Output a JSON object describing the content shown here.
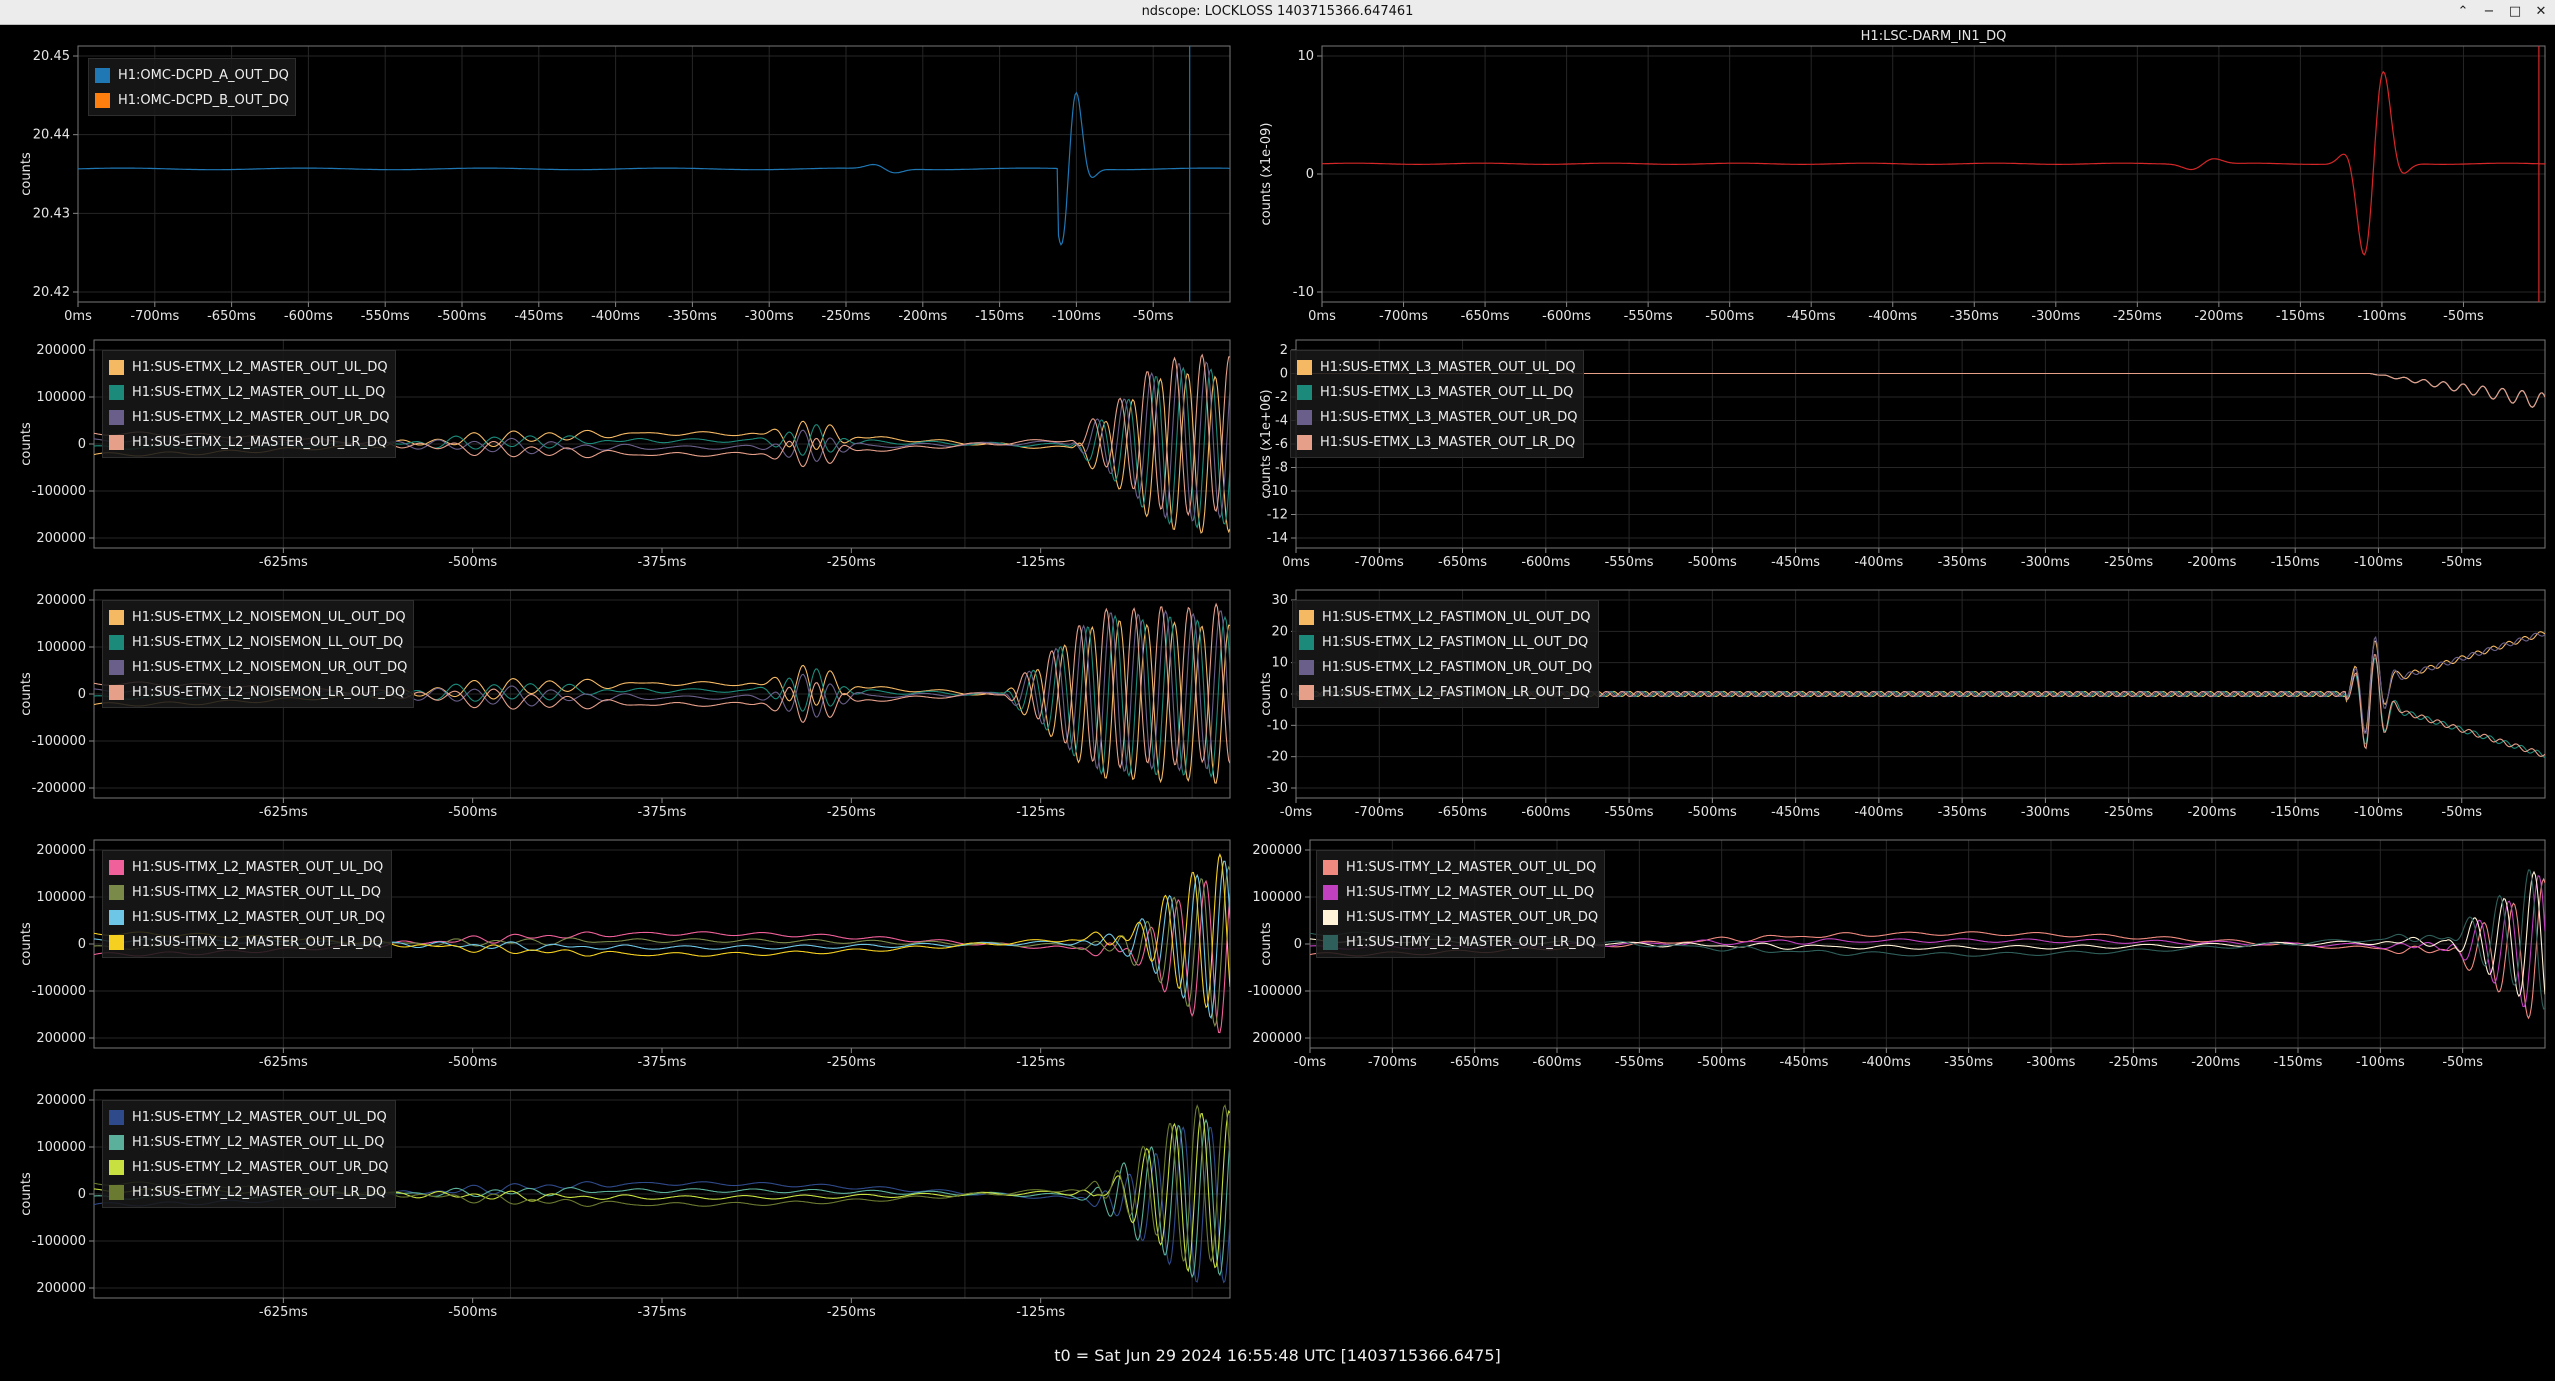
{
  "window": {
    "title": "ndscope: LOCKLOSS 1403715366.647461",
    "controls": [
      "⌃",
      "−",
      "□",
      "✕"
    ]
  },
  "footer": {
    "t0": "t0 = Sat Jun 29 2024 16:55:48 UTC [1403715366.6475]"
  },
  "plots": [
    {
      "id": "p1",
      "title": "",
      "ylabel": "counts",
      "yticks": [
        "20.45",
        "20.44",
        "20.43",
        "20.42"
      ],
      "xticks": [
        "0ms",
        "-700ms",
        "-650ms",
        "-600ms",
        "-550ms",
        "-500ms",
        "-450ms",
        "-400ms",
        "-350ms",
        "-300ms",
        "-250ms",
        "-200ms",
        "-150ms",
        "-100ms",
        "-50ms"
      ],
      "legend": [
        {
          "label": "H1:OMC-DCPD_A_OUT_DQ",
          "color": "#1f77b4"
        },
        {
          "label": "H1:OMC-DCPD_B_OUT_DQ",
          "color": "#ff7f0e"
        }
      ]
    },
    {
      "id": "p2",
      "title": "H1:LSC-DARM_IN1_DQ",
      "ylabel": "counts (x1e-09)",
      "yticks": [
        "10",
        "0",
        "-10"
      ],
      "xticks": [
        "0ms",
        "-700ms",
        "-650ms",
        "-600ms",
        "-550ms",
        "-500ms",
        "-450ms",
        "-400ms",
        "-350ms",
        "-300ms",
        "-250ms",
        "-200ms",
        "-150ms",
        "-100ms",
        "-50ms"
      ],
      "legend": []
    },
    {
      "id": "p3",
      "title": "",
      "ylabel": "counts",
      "yticks": [
        "200000",
        "100000",
        "0",
        "-100000",
        "200000"
      ],
      "xticks": [
        "-625ms",
        "-500ms",
        "-375ms",
        "-250ms",
        "-125ms"
      ],
      "legend": [
        {
          "label": "H1:SUS-ETMX_L2_MASTER_OUT_UL_DQ",
          "color": "#f5b964"
        },
        {
          "label": "H1:SUS-ETMX_L2_MASTER_OUT_LL_DQ",
          "color": "#1b8a7a"
        },
        {
          "label": "H1:SUS-ETMX_L2_MASTER_OUT_UR_DQ",
          "color": "#6a5f8a"
        },
        {
          "label": "H1:SUS-ETMX_L2_MASTER_OUT_LR_DQ",
          "color": "#e6a08a"
        }
      ]
    },
    {
      "id": "p4",
      "title": "",
      "ylabel": "counts (x1e+06)",
      "yticks": [
        "2",
        "0",
        "-2",
        "-4",
        "-6",
        "-8",
        "-10",
        "-12",
        "-14"
      ],
      "xticks": [
        "0ms",
        "-700ms",
        "-650ms",
        "-600ms",
        "-550ms",
        "-500ms",
        "-450ms",
        "-400ms",
        "-350ms",
        "-300ms",
        "-250ms",
        "-200ms",
        "-150ms",
        "-100ms",
        "-50ms"
      ],
      "legend": [
        {
          "label": "H1:SUS-ETMX_L3_MASTER_OUT_UL_DQ",
          "color": "#f5b964"
        },
        {
          "label": "H1:SUS-ETMX_L3_MASTER_OUT_LL_DQ",
          "color": "#1b8a7a"
        },
        {
          "label": "H1:SUS-ETMX_L3_MASTER_OUT_UR_DQ",
          "color": "#6a5f8a"
        },
        {
          "label": "H1:SUS-ETMX_L3_MASTER_OUT_LR_DQ",
          "color": "#e6a08a"
        }
      ]
    },
    {
      "id": "p5",
      "title": "",
      "ylabel": "counts",
      "yticks": [
        "200000",
        "100000",
        "0",
        "-100000",
        "-200000"
      ],
      "xticks": [
        "-625ms",
        "-500ms",
        "-375ms",
        "-250ms",
        "-125ms"
      ],
      "legend": [
        {
          "label": "H1:SUS-ETMX_L2_NOISEMON_UL_OUT_DQ",
          "color": "#f5b964"
        },
        {
          "label": "H1:SUS-ETMX_L2_NOISEMON_LL_OUT_DQ",
          "color": "#1b8a7a"
        },
        {
          "label": "H1:SUS-ETMX_L2_NOISEMON_UR_OUT_DQ",
          "color": "#6a5f8a"
        },
        {
          "label": "H1:SUS-ETMX_L2_NOISEMON_LR_OUT_DQ",
          "color": "#e6a08a"
        }
      ]
    },
    {
      "id": "p6",
      "title": "",
      "ylabel": "counts",
      "yticks": [
        "30",
        "20",
        "10",
        "0",
        "-10",
        "-20",
        "-30"
      ],
      "xticks": [
        "-0ms",
        "-700ms",
        "-650ms",
        "-600ms",
        "-550ms",
        "-500ms",
        "-450ms",
        "-400ms",
        "-350ms",
        "-300ms",
        "-250ms",
        "-200ms",
        "-150ms",
        "-100ms",
        "-50ms"
      ],
      "legend": [
        {
          "label": "H1:SUS-ETMX_L2_FASTIMON_UL_OUT_DQ",
          "color": "#f5b964"
        },
        {
          "label": "H1:SUS-ETMX_L2_FASTIMON_LL_OUT_DQ",
          "color": "#1b8a7a"
        },
        {
          "label": "H1:SUS-ETMX_L2_FASTIMON_UR_OUT_DQ",
          "color": "#6a5f8a"
        },
        {
          "label": "H1:SUS-ETMX_L2_FASTIMON_LR_OUT_DQ",
          "color": "#e6a08a"
        }
      ]
    },
    {
      "id": "p7",
      "title": "",
      "ylabel": "counts",
      "yticks": [
        "200000",
        "100000",
        "0",
        "-100000",
        "200000"
      ],
      "xticks": [
        "-625ms",
        "-500ms",
        "-375ms",
        "-250ms",
        "-125ms"
      ],
      "legend": [
        {
          "label": "H1:SUS-ITMX_L2_MASTER_OUT_UL_DQ",
          "color": "#f0609a"
        },
        {
          "label": "H1:SUS-ITMX_L2_MASTER_OUT_LL_DQ",
          "color": "#7a8a48"
        },
        {
          "label": "H1:SUS-ITMX_L2_MASTER_OUT_UR_DQ",
          "color": "#6ec6e6"
        },
        {
          "label": "H1:SUS-ITMX_L2_MASTER_OUT_LR_DQ",
          "color": "#f5d020"
        }
      ]
    },
    {
      "id": "p8",
      "title": "",
      "ylabel": "counts",
      "yticks": [
        "200000",
        "100000",
        "0",
        "-100000",
        "200000"
      ],
      "xticks": [
        "-0ms",
        "-700ms",
        "-650ms",
        "-600ms",
        "-550ms",
        "-500ms",
        "-450ms",
        "-400ms",
        "-350ms",
        "-300ms",
        "-250ms",
        "-200ms",
        "-150ms",
        "-100ms",
        "-50ms"
      ],
      "legend": [
        {
          "label": "H1:SUS-ITMY_L2_MASTER_OUT_UL_DQ",
          "color": "#f08a80"
        },
        {
          "label": "H1:SUS-ITMY_L2_MASTER_OUT_LL_DQ",
          "color": "#c040c0"
        },
        {
          "label": "H1:SUS-ITMY_L2_MASTER_OUT_UR_DQ",
          "color": "#fff2d6"
        },
        {
          "label": "H1:SUS-ITMY_L2_MASTER_OUT_LR_DQ",
          "color": "#2f5f5a"
        }
      ]
    },
    {
      "id": "p9",
      "title": "",
      "ylabel": "counts",
      "yticks": [
        "200000",
        "100000",
        "0",
        "-100000",
        "200000"
      ],
      "xticks": [
        "-625ms",
        "-500ms",
        "-375ms",
        "-250ms",
        "-125ms"
      ],
      "legend": [
        {
          "label": "H1:SUS-ETMY_L2_MASTER_OUT_UL_DQ",
          "color": "#2f4a8a"
        },
        {
          "label": "H1:SUS-ETMY_L2_MASTER_OUT_LL_DQ",
          "color": "#5ab09a"
        },
        {
          "label": "H1:SUS-ETMY_L2_MASTER_OUT_UR_DQ",
          "color": "#c8e040"
        },
        {
          "label": "H1:SUS-ETMY_L2_MASTER_OUT_LR_DQ",
          "color": "#6a7a30"
        }
      ]
    }
  ]
}
